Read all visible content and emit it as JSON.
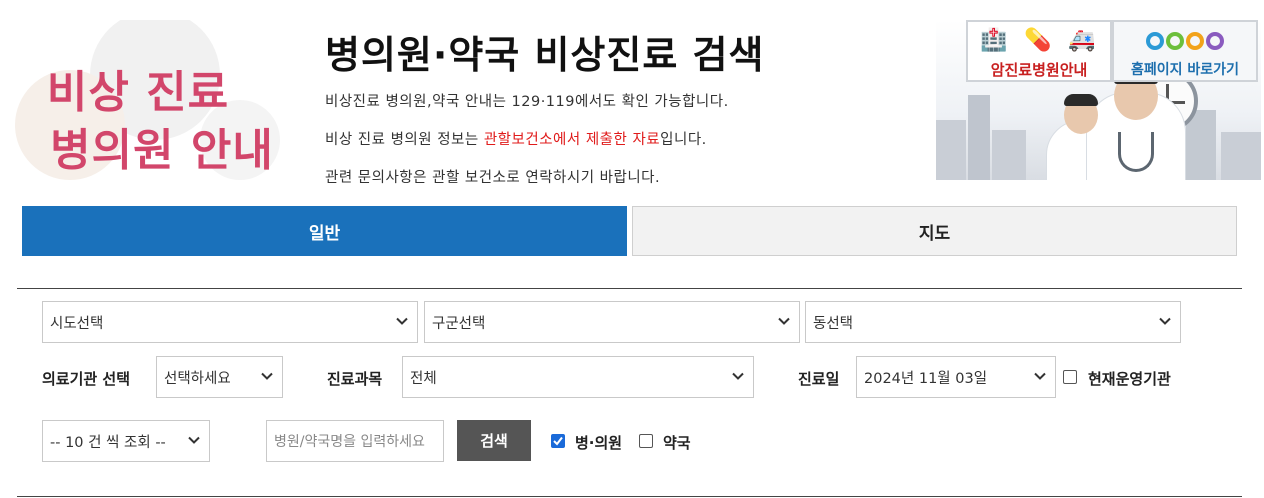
{
  "banner": {
    "hero_line1": "비상 진료",
    "hero_line2": "병의원 안내",
    "title": "병의원·약국 비상진료 검색",
    "desc1": "비상진료 병의원,약국 안내는 129·119에서도 확인 가능합니다.",
    "desc2_prefix": "비상 진료 병의원 정보는 ",
    "desc2_highlight": "관할보건소에서 제출한 자료",
    "desc2_suffix": "입니다.",
    "desc3": "관련 문의사항은 관할 보건소로 연락하시기 바랍니다.",
    "highlight_color": "#e01b1b",
    "hero_color": "#d2466b"
  },
  "quick_links": {
    "cancer_hospital": "암진료병원안내",
    "homepage": "홈페이지 바로가기"
  },
  "tabs": [
    {
      "label": "일반",
      "active": true
    },
    {
      "label": "지도",
      "active": false
    }
  ],
  "search": {
    "sido": "시도선택",
    "gugun": "구군선택",
    "dong": "동선택",
    "institution_label": "의료기관 선택",
    "institution_value": "선택하세요",
    "department_label": "진료과목",
    "department_value": "전체",
    "date_label": "진료일",
    "date_value": "2024년 11월 03일",
    "open_now_label": "현재운영기관",
    "page_size": "-- 10 건 씩 조회 --",
    "name_placeholder": "병원/약국명을 입력하세요",
    "search_button": "검색",
    "hospital_label": "병·의원",
    "pharmacy_label": "약국",
    "hospital_checked": true,
    "pharmacy_checked": false,
    "open_now_checked": false
  },
  "colors": {
    "tab_active": "#1a71bb",
    "search_button": "#555555"
  }
}
